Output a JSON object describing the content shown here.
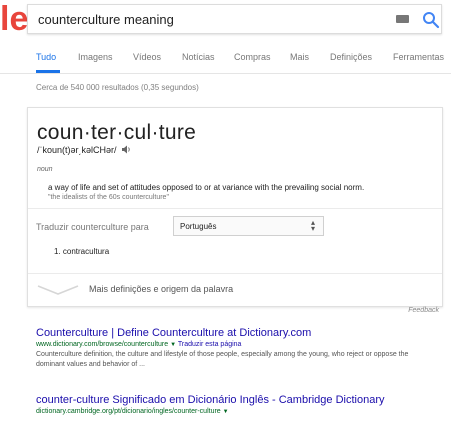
{
  "logo_fragment": "le",
  "search": {
    "query": "counterculture meaning"
  },
  "tabs": [
    {
      "label": "Tudo",
      "active": true
    },
    {
      "label": "Imagens",
      "active": false
    },
    {
      "label": "Vídeos",
      "active": false
    },
    {
      "label": "Notícias",
      "active": false
    },
    {
      "label": "Compras",
      "active": false
    },
    {
      "label": "Mais",
      "active": false
    },
    {
      "label": "Definições",
      "active": false
    },
    {
      "label": "Ferramentas",
      "active": false
    }
  ],
  "result_stats": "Cerca de 540 000 resultados (0,35 segundos)",
  "dictionary": {
    "headword": "coun·ter·cul·ture",
    "pronunciation": "/ˈkoun(t)ər͵kəlCHər/",
    "part_of_speech": "noun",
    "definition": "a way of life and set of attitudes opposed to or at variance with the prevailing social norm.",
    "example": "\"the idealists of the 60s counterculture\"",
    "translate_label": "Traduzir counterculture para",
    "translate_language": "Português",
    "translation": "1. contracultura",
    "more_defs": "Mais definições e origem da palavra"
  },
  "feedback": "Feedback",
  "results": [
    {
      "title": "Counterculture | Define Counterculture at Dictionary.com",
      "url": "www.dictionary.com/browse/counterculture",
      "translate_link": "Traduzir esta página",
      "snippet": "Counterculture definition, the culture and lifestyle of those people, especially among the young, who reject or oppose the dominant values and behavior of ..."
    },
    {
      "title": "counter-culture Significado em Dicionário Inglês - Cambridge Dictionary",
      "url": "dictionary.cambridge.org/pt/dicionario/ingles/counter-culture",
      "translate_link": "",
      "snippet": ""
    }
  ],
  "colors": {
    "link": "#1a0dab",
    "url_green": "#006621",
    "accent_blue": "#1a73e8",
    "logo_red": "#e8453c"
  }
}
